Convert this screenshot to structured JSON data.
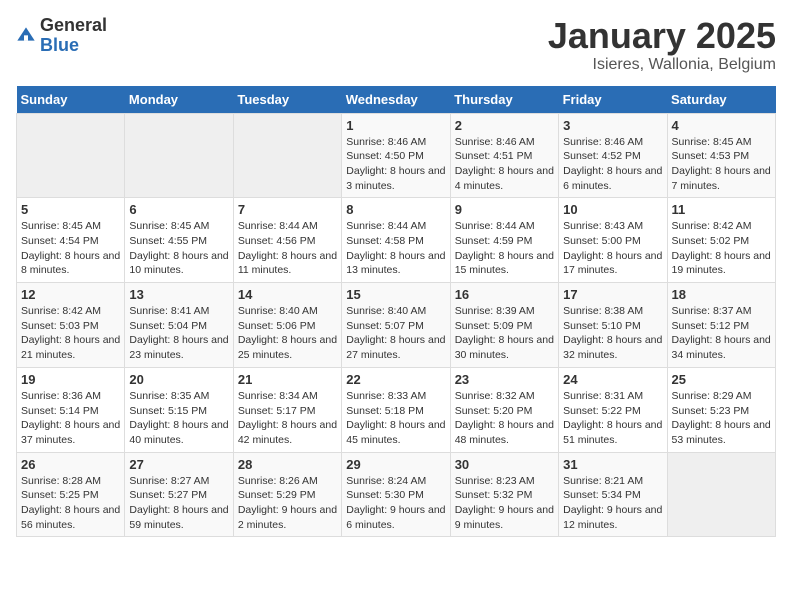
{
  "header": {
    "logo_general": "General",
    "logo_blue": "Blue",
    "title": "January 2025",
    "subtitle": "Isieres, Wallonia, Belgium"
  },
  "calendar": {
    "days_of_week": [
      "Sunday",
      "Monday",
      "Tuesday",
      "Wednesday",
      "Thursday",
      "Friday",
      "Saturday"
    ],
    "weeks": [
      [
        {
          "day": "",
          "info": ""
        },
        {
          "day": "",
          "info": ""
        },
        {
          "day": "",
          "info": ""
        },
        {
          "day": "1",
          "info": "Sunrise: 8:46 AM\nSunset: 4:50 PM\nDaylight: 8 hours and 3 minutes."
        },
        {
          "day": "2",
          "info": "Sunrise: 8:46 AM\nSunset: 4:51 PM\nDaylight: 8 hours and 4 minutes."
        },
        {
          "day": "3",
          "info": "Sunrise: 8:46 AM\nSunset: 4:52 PM\nDaylight: 8 hours and 6 minutes."
        },
        {
          "day": "4",
          "info": "Sunrise: 8:45 AM\nSunset: 4:53 PM\nDaylight: 8 hours and 7 minutes."
        }
      ],
      [
        {
          "day": "5",
          "info": "Sunrise: 8:45 AM\nSunset: 4:54 PM\nDaylight: 8 hours and 8 minutes."
        },
        {
          "day": "6",
          "info": "Sunrise: 8:45 AM\nSunset: 4:55 PM\nDaylight: 8 hours and 10 minutes."
        },
        {
          "day": "7",
          "info": "Sunrise: 8:44 AM\nSunset: 4:56 PM\nDaylight: 8 hours and 11 minutes."
        },
        {
          "day": "8",
          "info": "Sunrise: 8:44 AM\nSunset: 4:58 PM\nDaylight: 8 hours and 13 minutes."
        },
        {
          "day": "9",
          "info": "Sunrise: 8:44 AM\nSunset: 4:59 PM\nDaylight: 8 hours and 15 minutes."
        },
        {
          "day": "10",
          "info": "Sunrise: 8:43 AM\nSunset: 5:00 PM\nDaylight: 8 hours and 17 minutes."
        },
        {
          "day": "11",
          "info": "Sunrise: 8:42 AM\nSunset: 5:02 PM\nDaylight: 8 hours and 19 minutes."
        }
      ],
      [
        {
          "day": "12",
          "info": "Sunrise: 8:42 AM\nSunset: 5:03 PM\nDaylight: 8 hours and 21 minutes."
        },
        {
          "day": "13",
          "info": "Sunrise: 8:41 AM\nSunset: 5:04 PM\nDaylight: 8 hours and 23 minutes."
        },
        {
          "day": "14",
          "info": "Sunrise: 8:40 AM\nSunset: 5:06 PM\nDaylight: 8 hours and 25 minutes."
        },
        {
          "day": "15",
          "info": "Sunrise: 8:40 AM\nSunset: 5:07 PM\nDaylight: 8 hours and 27 minutes."
        },
        {
          "day": "16",
          "info": "Sunrise: 8:39 AM\nSunset: 5:09 PM\nDaylight: 8 hours and 30 minutes."
        },
        {
          "day": "17",
          "info": "Sunrise: 8:38 AM\nSunset: 5:10 PM\nDaylight: 8 hours and 32 minutes."
        },
        {
          "day": "18",
          "info": "Sunrise: 8:37 AM\nSunset: 5:12 PM\nDaylight: 8 hours and 34 minutes."
        }
      ],
      [
        {
          "day": "19",
          "info": "Sunrise: 8:36 AM\nSunset: 5:14 PM\nDaylight: 8 hours and 37 minutes."
        },
        {
          "day": "20",
          "info": "Sunrise: 8:35 AM\nSunset: 5:15 PM\nDaylight: 8 hours and 40 minutes."
        },
        {
          "day": "21",
          "info": "Sunrise: 8:34 AM\nSunset: 5:17 PM\nDaylight: 8 hours and 42 minutes."
        },
        {
          "day": "22",
          "info": "Sunrise: 8:33 AM\nSunset: 5:18 PM\nDaylight: 8 hours and 45 minutes."
        },
        {
          "day": "23",
          "info": "Sunrise: 8:32 AM\nSunset: 5:20 PM\nDaylight: 8 hours and 48 minutes."
        },
        {
          "day": "24",
          "info": "Sunrise: 8:31 AM\nSunset: 5:22 PM\nDaylight: 8 hours and 51 minutes."
        },
        {
          "day": "25",
          "info": "Sunrise: 8:29 AM\nSunset: 5:23 PM\nDaylight: 8 hours and 53 minutes."
        }
      ],
      [
        {
          "day": "26",
          "info": "Sunrise: 8:28 AM\nSunset: 5:25 PM\nDaylight: 8 hours and 56 minutes."
        },
        {
          "day": "27",
          "info": "Sunrise: 8:27 AM\nSunset: 5:27 PM\nDaylight: 8 hours and 59 minutes."
        },
        {
          "day": "28",
          "info": "Sunrise: 8:26 AM\nSunset: 5:29 PM\nDaylight: 9 hours and 2 minutes."
        },
        {
          "day": "29",
          "info": "Sunrise: 8:24 AM\nSunset: 5:30 PM\nDaylight: 9 hours and 6 minutes."
        },
        {
          "day": "30",
          "info": "Sunrise: 8:23 AM\nSunset: 5:32 PM\nDaylight: 9 hours and 9 minutes."
        },
        {
          "day": "31",
          "info": "Sunrise: 8:21 AM\nSunset: 5:34 PM\nDaylight: 9 hours and 12 minutes."
        },
        {
          "day": "",
          "info": ""
        }
      ]
    ]
  }
}
